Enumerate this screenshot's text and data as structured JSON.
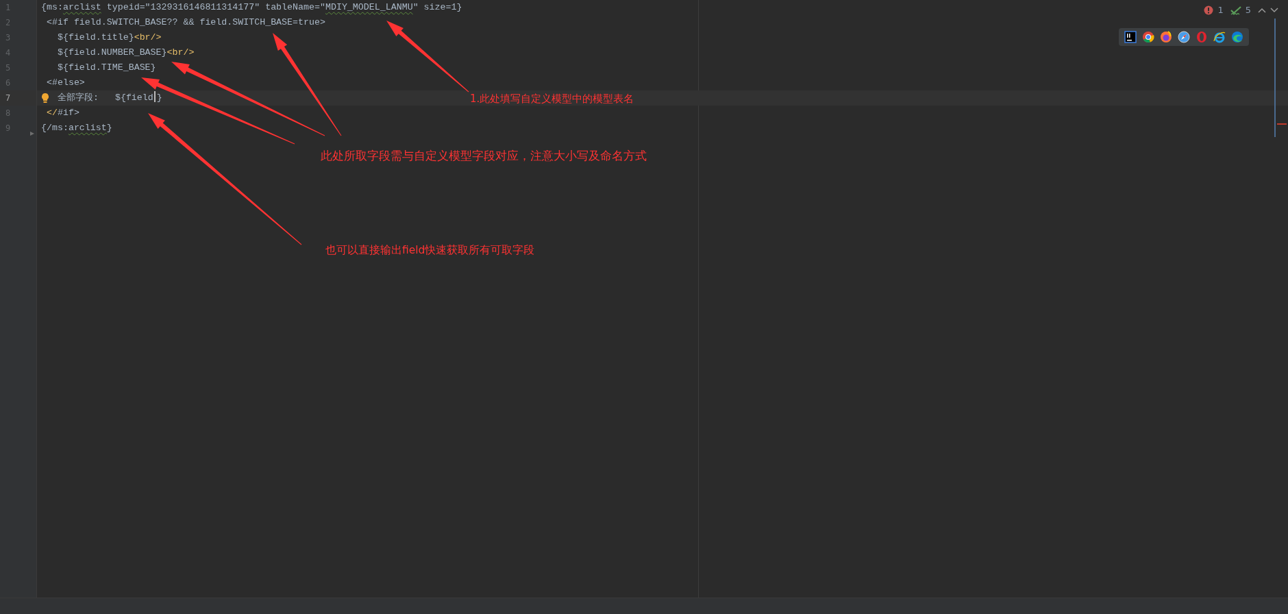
{
  "editor": {
    "lines": [
      {
        "number": "1",
        "current": false,
        "segments": [
          {
            "kind": "text",
            "text": "{ms:"
          },
          {
            "kind": "text",
            "text": "arclist",
            "squiggle": true
          },
          {
            "kind": "text",
            "text": " typeid=\"1329316146811314177\" tableName=\""
          },
          {
            "kind": "text",
            "text": "MDIY_MODEL_LANMU",
            "squiggle": true
          },
          {
            "kind": "text",
            "text": "\" size=1}"
          }
        ]
      },
      {
        "number": "2",
        "current": false,
        "segments": [
          {
            "kind": "text",
            "text": " <#if field.SWITCH_BASE?? && field.SWITCH_BASE=true>"
          }
        ]
      },
      {
        "number": "3",
        "current": false,
        "segments": [
          {
            "kind": "text",
            "text": "   ${field.title}"
          },
          {
            "kind": "tag",
            "text": "<br/>"
          }
        ]
      },
      {
        "number": "4",
        "current": false,
        "segments": [
          {
            "kind": "text",
            "text": "   ${field.NUMBER_BASE}"
          },
          {
            "kind": "tag",
            "text": "<br/>"
          }
        ]
      },
      {
        "number": "5",
        "current": false,
        "segments": [
          {
            "kind": "text",
            "text": "   ${field.TIME_BASE}"
          }
        ]
      },
      {
        "number": "6",
        "current": false,
        "segments": [
          {
            "kind": "text",
            "text": " <#else>"
          }
        ]
      },
      {
        "number": "7",
        "current": true,
        "hint": true,
        "segments": [
          {
            "kind": "text",
            "text": "全部字段:   ${field"
          },
          {
            "kind": "caret"
          },
          {
            "kind": "text",
            "text": "}"
          }
        ]
      },
      {
        "number": "8",
        "current": false,
        "segments": [
          {
            "kind": "tag",
            "text": " </"
          },
          {
            "kind": "text",
            "text": "#if>"
          }
        ]
      },
      {
        "number": "9",
        "current": false,
        "segments": [
          {
            "kind": "text",
            "text": "{/ms:"
          },
          {
            "kind": "text",
            "text": "arclist",
            "squiggle": true
          },
          {
            "kind": "text",
            "text": "}"
          }
        ]
      }
    ]
  },
  "inspections": {
    "errors": "1",
    "warnings": "5"
  },
  "annotations": [
    {
      "text": "1.此处填写自定义模型中的模型表名"
    },
    {
      "text": "此处所取字段需与自定义模型字段对应，注意大小写及命名方式"
    },
    {
      "text": "也可以直接输出field快速获取所有可取字段"
    }
  ]
}
